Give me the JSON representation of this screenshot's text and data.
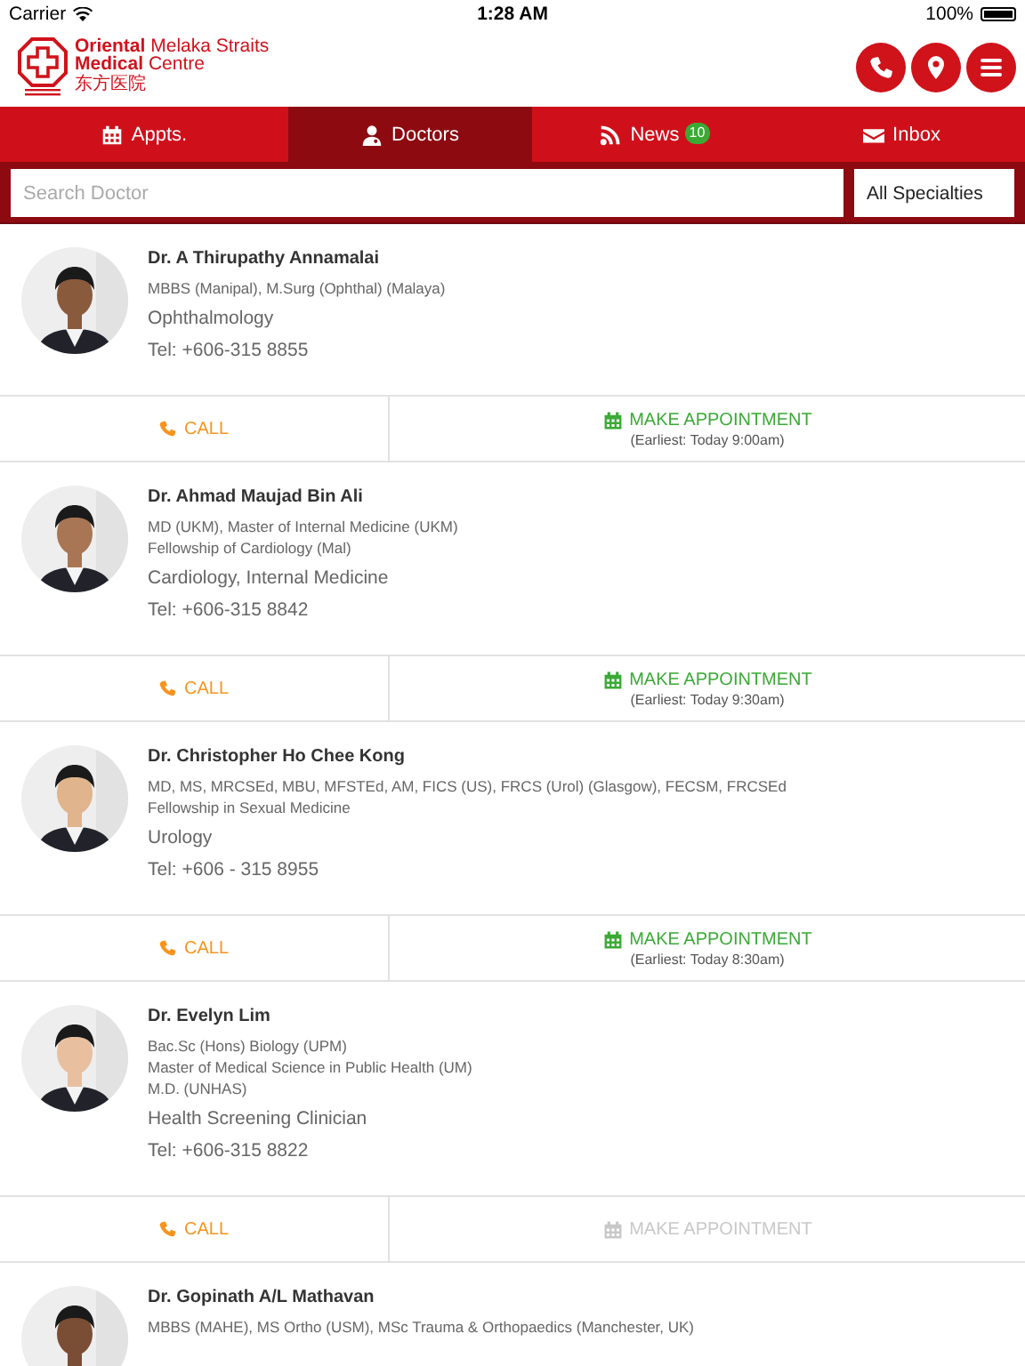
{
  "status_bar": {
    "carrier": "Carrier",
    "time": "1:28 AM",
    "battery": "100%"
  },
  "header": {
    "logo_name_bold_1": "Oriental",
    "logo_name_rest_1": "Melaka Straits",
    "logo_name_bold_2": "Medical",
    "logo_name_rest_2": "Centre",
    "logo_chinese": "东方医院"
  },
  "tabs": [
    {
      "kind": "calendar",
      "label": "Appts.",
      "selected": false
    },
    {
      "kind": "doctor",
      "label": "Doctors",
      "selected": true
    },
    {
      "kind": "rss",
      "label": "News",
      "badge": "10",
      "selected": false
    },
    {
      "kind": "mail",
      "label": "Inbox",
      "selected": false
    }
  ],
  "search": {
    "placeholder": "Search Doctor",
    "specialty": "All Specialties"
  },
  "doctors": [
    {
      "name": "Dr. A Thirupathy Annamalai",
      "qualifications": [
        "MBBS (Manipal), M.Surg (Ophthal) (Malaya)"
      ],
      "specialty": "Ophthalmology",
      "tel": "Tel: +606-315 8855",
      "call": "CALL",
      "appointment": "MAKE APPOINTMENT",
      "appointment_enabled": true,
      "earliest": "(Earliest: Today 9:00am)"
    },
    {
      "name": "Dr. Ahmad Maujad Bin Ali",
      "qualifications": [
        "MD (UKM), Master of Internal Medicine (UKM)",
        "Fellowship of Cardiology (Mal)"
      ],
      "specialty": "Cardiology, Internal Medicine",
      "tel": "Tel: +606-315 8842",
      "call": "CALL",
      "appointment": "MAKE APPOINTMENT",
      "appointment_enabled": true,
      "earliest": "(Earliest: Today 9:30am)"
    },
    {
      "name": "Dr. Christopher Ho Chee Kong",
      "qualifications": [
        "MD, MS, MRCSEd, MBU, MFSTEd, AM, FICS (US), FRCS (Urol) (Glasgow), FECSM, FRCSEd",
        "Fellowship in Sexual Medicine"
      ],
      "specialty": "Urology",
      "tel": "Tel: +606 - 315 8955",
      "call": "CALL",
      "appointment": "MAKE APPOINTMENT",
      "appointment_enabled": true,
      "earliest": "(Earliest: Today 8:30am)"
    },
    {
      "name": "Dr. Evelyn Lim",
      "qualifications": [
        "Bac.Sc (Hons) Biology (UPM)",
        "Master of Medical Science in Public Health (UM)",
        "M.D. (UNHAS)"
      ],
      "specialty": "Health Screening Clinician",
      "tel": "Tel: +606-315 8822",
      "call": "CALL",
      "appointment": "MAKE APPOINTMENT",
      "appointment_enabled": false
    },
    {
      "name": "Dr. Gopinath A/L Mathavan",
      "qualifications": [
        "MBBS (MAHE), MS Ortho (USM), MSc Trauma & Orthopaedics (Manchester, UK)"
      ]
    }
  ]
}
